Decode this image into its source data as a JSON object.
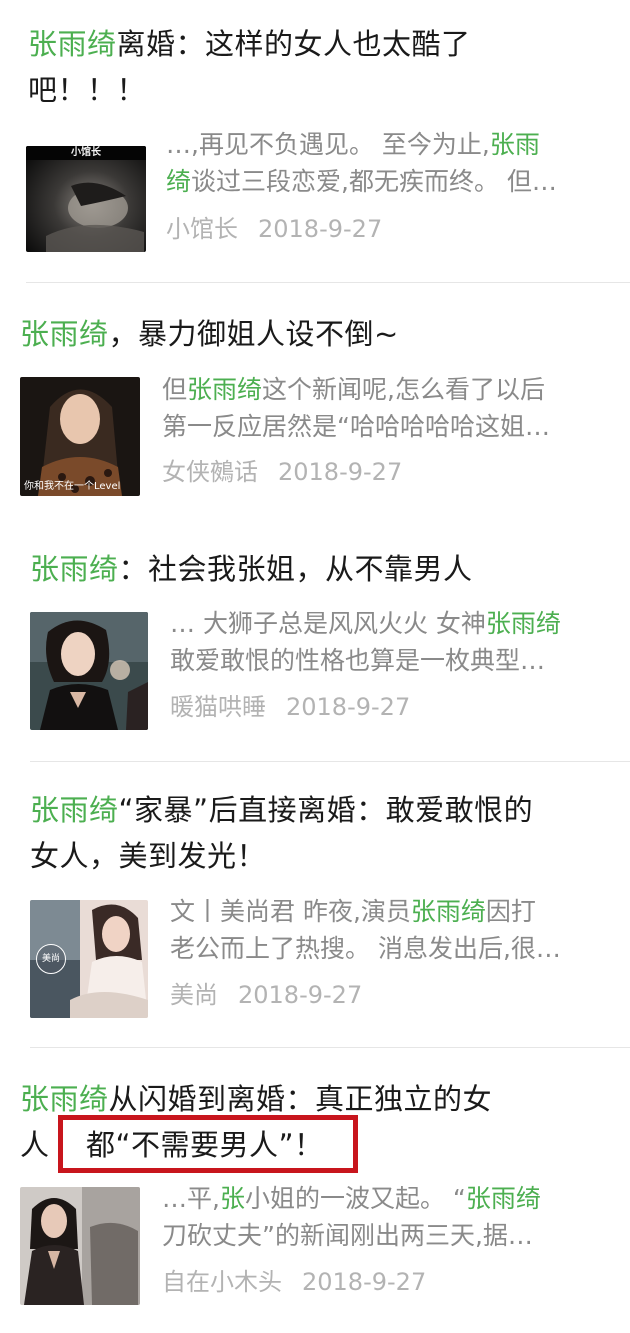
{
  "highlight_color": "#4caf50",
  "annotation_color": "#c8151d",
  "results": [
    {
      "title_line1": [
        "张雨绮",
        "离婚：这样的女人也太酷了"
      ],
      "title_line2": "吧！！！",
      "thumb_caption": "小馆长",
      "snippet_line1": [
        "…,再见不负遇见。 至今为止,",
        "张雨"
      ],
      "snippet_line2": [
        "绮",
        "谈过三段恋爱,都无疾而终。 但…"
      ],
      "source": "小馆长",
      "date": "2018-9-27"
    },
    {
      "title_line1": [
        "张雨绮",
        "，暴力御姐人设不倒~"
      ],
      "thumb_caption": "你和我不在一个Level",
      "snippet_line1": [
        "但",
        "张雨绮",
        "这个新闻呢,怎么看了以后"
      ],
      "snippet_line2": "第一反应居然是“哈哈哈哈哈这姐…",
      "source": "女侠鵺话",
      "date": "2018-9-27"
    },
    {
      "title_line1": [
        "张雨绮",
        "：社会我张姐，从不靠男人"
      ],
      "snippet_line1": [
        "… 大狮子总是风风火火 女神",
        "张雨绮"
      ],
      "snippet_line2": "敢爱敢恨的性格也算是一枚典型…",
      "source": "暖猫哄睡",
      "date": "2018-9-27"
    },
    {
      "title_line1": [
        "张雨绮",
        "“家暴”后直接离婚：敢爱敢恨的"
      ],
      "title_line2": "女人，美到发光！",
      "thumb_caption": "美尚",
      "snippet_line1": [
        "文丨美尚君 昨夜,演员",
        "张雨绮",
        "因打"
      ],
      "snippet_line2": "老公而上了热搜。 消息发出后,很…",
      "source": "美尚",
      "date": "2018-9-27"
    },
    {
      "title_line1": [
        "张雨绮",
        "从闪婚到离婚：真正独立的女"
      ],
      "title_line2_prefix": "人",
      "title_line2_boxed": "都“不需要男人”！",
      "snippet_line1": [
        "…平,",
        "张",
        "小姐的一波又起。 “",
        "张雨绮"
      ],
      "snippet_line2": "刀砍丈夫”的新闻刚出两三天,据…",
      "source": "自在小木头",
      "date": "2018-9-27"
    }
  ]
}
